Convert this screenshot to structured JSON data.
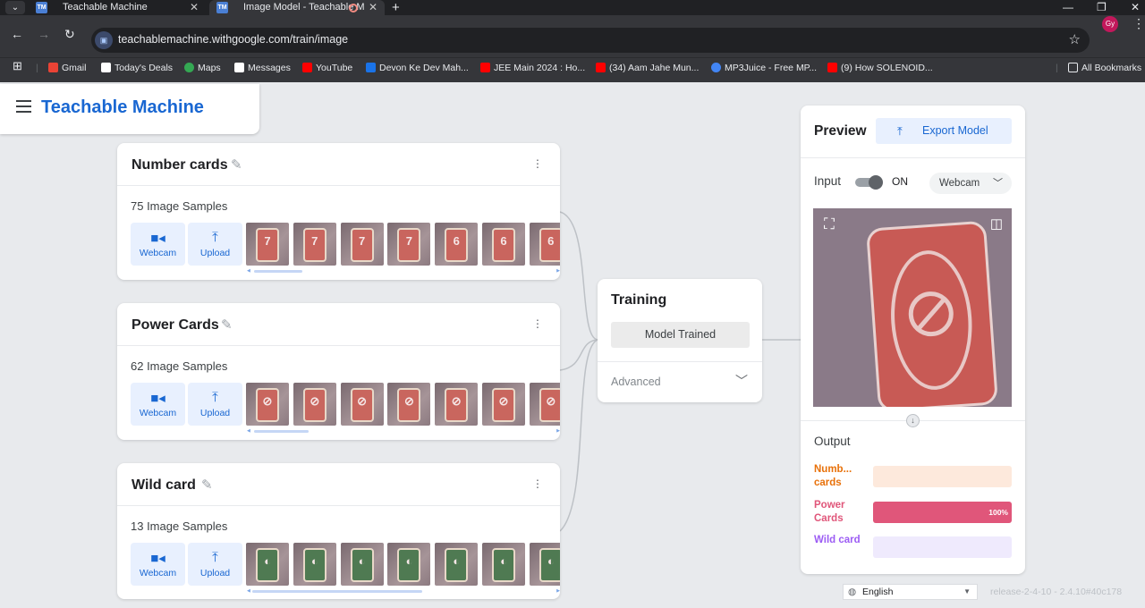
{
  "browser": {
    "tabs": [
      {
        "title": "Teachable Machine",
        "favicon": "TM",
        "close": "✕"
      },
      {
        "title": "Image Model - Teachable M",
        "favicon": "TM",
        "close": "✕"
      }
    ],
    "new_tab": "+",
    "window": {
      "minimize": "—",
      "restore": "❐",
      "close": "✕"
    },
    "url": "teachablemachine.withgoogle.com/train/image",
    "profile_initials": "Gy",
    "bookmarks": [
      {
        "label": "Gmail",
        "icon": "gmail-icon",
        "color": "#ea4335"
      },
      {
        "label": "Today's Deals",
        "icon": "amazon-icon",
        "color": "#ffffff"
      },
      {
        "label": "Maps",
        "icon": "maps-icon",
        "color": "#34a853"
      },
      {
        "label": "Messages",
        "icon": "x-icon",
        "color": "#ffffff"
      },
      {
        "label": "YouTube",
        "icon": "youtube-icon",
        "color": "#ff0000"
      },
      {
        "label": "Devon Ke Dev Mah...",
        "icon": "info-icon",
        "color": "#1a73e8"
      },
      {
        "label": "JEE Main 2024 : Ho...",
        "icon": "youtube-icon",
        "color": "#ff0000"
      },
      {
        "label": "(34) Aam Jahe Mun...",
        "icon": "youtube-icon",
        "color": "#ff0000"
      },
      {
        "label": "MP3Juice - Free MP...",
        "icon": "mp3juice-icon",
        "color": "#4285f4"
      },
      {
        "label": "(9) How SOLENOID...",
        "icon": "youtube-icon",
        "color": "#ff0000"
      }
    ],
    "all_bookmarks": "All Bookmarks"
  },
  "app": {
    "brand": "Teachable Machine",
    "classes": [
      {
        "name": "Number cards",
        "samples": "75 Image Samples",
        "thumb_symbols": [
          "7",
          "7",
          "7",
          "7",
          "6",
          "6",
          "6"
        ],
        "thumb_color": "#c9655e",
        "scroll_fraction": 0.1
      },
      {
        "name": "Power Cards",
        "samples": "62 Image Samples",
        "thumb_symbols": [
          "⊘",
          "⊘",
          "⊘",
          "⊘",
          "⊘",
          "⊘",
          "⊘"
        ],
        "thumb_color": "#c9665e",
        "scroll_fraction": 0.12
      },
      {
        "name": "Wild card",
        "samples": "13 Image Samples",
        "thumb_symbols": [
          "◐",
          "◐",
          "◐",
          "◐",
          "◐",
          "◐",
          "◐"
        ],
        "thumb_color": "#4f7a52",
        "scroll_fraction": 0.5
      }
    ],
    "source_buttons": {
      "webcam": "Webcam",
      "upload": "Upload"
    },
    "training": {
      "title": "Training",
      "status_button": "Model Trained",
      "advanced": "Advanced"
    },
    "preview": {
      "title": "Preview",
      "export": "Export Model",
      "input_label": "Input",
      "toggle_state": "ON",
      "source_select": "Webcam",
      "output_label": "Output",
      "outputs": [
        {
          "label": "Numb... cards",
          "percent": 0,
          "percent_text": "",
          "color": "#e8710a",
          "track": "#fde9dc"
        },
        {
          "label": "Power Cards",
          "percent": 100,
          "percent_text": "100%",
          "color": "#e0567a",
          "track": "#fce4ec"
        },
        {
          "label": "Wild card",
          "percent": 0,
          "percent_text": "",
          "color": "#9c5cf4",
          "track": "#efeafd"
        }
      ]
    },
    "language": "English",
    "release": "release-2-4-10 - 2.4.10#40c178"
  }
}
